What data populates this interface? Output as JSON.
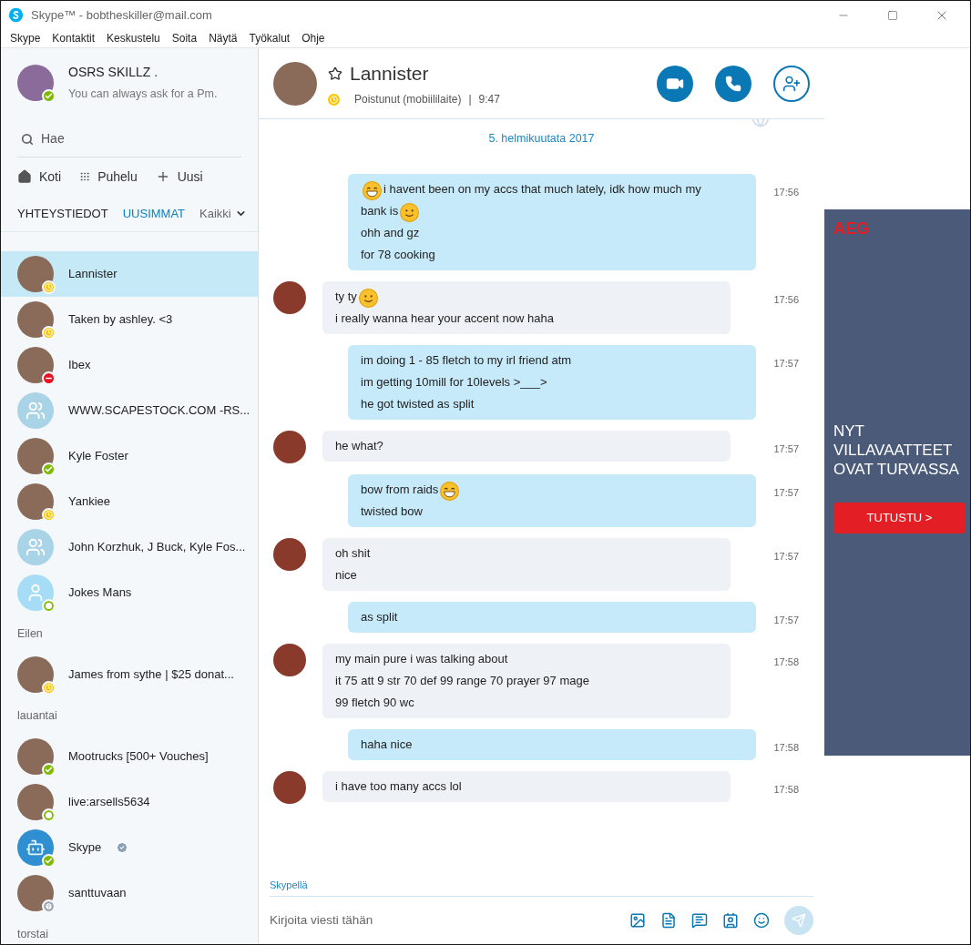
{
  "window": {
    "title": "Skype™ - bobtheskiller@mail.com"
  },
  "menu": [
    "Skype",
    "Kontaktit",
    "Keskustelu",
    "Soita",
    "Näytä",
    "Työkalut",
    "Ohje"
  ],
  "profile": {
    "name": "OSRS SKILLZ .",
    "mood": "You can always ask for a Pm.",
    "status": {
      "kind": "online",
      "color": "#7fba00"
    }
  },
  "search": {
    "placeholder": "Hae"
  },
  "nav": [
    {
      "kind": "home",
      "label": "Koti"
    },
    {
      "kind": "dialpad",
      "label": "Puhelu"
    },
    {
      "kind": "plus",
      "label": "Uusi"
    }
  ],
  "tabs": [
    {
      "label": "YHTEYSTIEDOT",
      "selected": false
    },
    {
      "label": "UUSIMMAT",
      "selected": true
    }
  ],
  "filter": {
    "label": "Kaikki"
  },
  "contact_sections": [
    {
      "contacts": [
        {
          "name": "Lannister",
          "kind": "photo",
          "status": {
            "kind": "away",
            "color": "#fdc400"
          },
          "selected": true
        },
        {
          "name": "Taken by ashley. <3",
          "kind": "photo",
          "status": {
            "kind": "away",
            "color": "#fdc400"
          },
          "selected": false
        },
        {
          "name": "Ibex",
          "kind": "photo",
          "status": {
            "kind": "busy",
            "color": "#e81123"
          },
          "selected": false
        },
        {
          "name": "WWW.SCAPESTOCK.COM -RS...",
          "kind": "group",
          "selected": false
        },
        {
          "name": "Kyle Foster",
          "kind": "photo",
          "status": {
            "kind": "online",
            "color": "#7fba00"
          },
          "selected": false
        },
        {
          "name": "Yankiee",
          "kind": "photo",
          "status": {
            "kind": "away",
            "color": "#fdc400"
          },
          "selected": false
        },
        {
          "name": "John Korzhuk, J Buck, Kyle Fos...",
          "kind": "group",
          "selected": false
        },
        {
          "name": "Jokes Mans",
          "kind": "person",
          "status": {
            "kind": "offline",
            "color": "#7fba00"
          },
          "selected": false
        }
      ]
    },
    {
      "label": "Eilen",
      "contacts": [
        {
          "name": "James from sythe | $25 donat...",
          "kind": "photo",
          "status": {
            "kind": "away",
            "color": "#fdc400"
          },
          "selected": false
        }
      ]
    },
    {
      "label": "lauantai",
      "contacts": [
        {
          "name": "Mootrucks [500+ Vouches]",
          "kind": "photo",
          "status": {
            "kind": "online",
            "color": "#7fba00"
          },
          "selected": false
        },
        {
          "name": "live:arsells5634",
          "kind": "photo",
          "status": {
            "kind": "offline",
            "color": "#7fba00"
          },
          "selected": false
        },
        {
          "name": "Skype",
          "kind": "bot",
          "status": {
            "kind": "online",
            "color": "#7fba00"
          },
          "selected": false,
          "verified": true
        },
        {
          "name": "santtuvaan",
          "kind": "photo",
          "status": {
            "kind": "unknown",
            "color": "#9aa5b1"
          },
          "selected": false
        }
      ]
    },
    {
      "label": "torstai"
    }
  ],
  "chat": {
    "name": "Lannister",
    "status": {
      "kind": "away",
      "color": "#fdc400"
    },
    "presence": "Poistunut (mobiililaite)",
    "separator": "|",
    "time": "9:47"
  },
  "date_label": "5. helmikuutata 2017",
  "messages": [
    {
      "kind": "sent",
      "time": "17:56",
      "lines": [
        {
          "text": "i havent been on my accs that much lately, idk how much my",
          "lead_emoji": {
            "kind": "grin"
          }
        },
        {
          "text": "bank is",
          "trail_emoji": {
            "kind": "smile"
          }
        },
        {
          "text": "ohh and gz"
        },
        {
          "text": "for 78 cooking"
        }
      ]
    },
    {
      "kind": "received",
      "time": "17:56",
      "lines": [
        {
          "text": "ty ty",
          "trail_emoji": {
            "kind": "smile"
          }
        },
        {
          "text": "i really wanna hear your accent now haha"
        }
      ]
    },
    {
      "kind": "sent",
      "time": "17:57",
      "lines": [
        {
          "text": "im doing 1 - 85 fletch to my irl friend atm"
        },
        {
          "text": "im getting 10mill for 10levels >___>"
        },
        {
          "text": "he got twisted as split"
        }
      ]
    },
    {
      "kind": "received",
      "time": "17:57",
      "lines": [
        {
          "text": "he what?"
        }
      ]
    },
    {
      "kind": "sent",
      "time": "17:57",
      "lines": [
        {
          "text": "bow from raids",
          "trail_emoji": {
            "kind": "grin"
          }
        },
        {
          "text": "twisted bow"
        }
      ]
    },
    {
      "kind": "received",
      "time": "17:57",
      "lines": [
        {
          "text": "oh shit"
        },
        {
          "text": "nice"
        }
      ]
    },
    {
      "kind": "sent",
      "time": "17:57",
      "lines": [
        {
          "text": "as split"
        }
      ]
    },
    {
      "kind": "received",
      "time": "17:58",
      "lines": [
        {
          "text": "my main pure i was talking about"
        },
        {
          "text": "it 75 att 9 str 70 def 99 range 70 prayer 97 mage"
        },
        {
          "text": "99 fletch 90 wc"
        }
      ]
    },
    {
      "kind": "sent",
      "time": "17:58",
      "lines": [
        {
          "text": "haha nice"
        }
      ]
    },
    {
      "kind": "received",
      "time": "17:58",
      "lines": [
        {
          "text": "i have too many accs lol"
        }
      ]
    }
  ],
  "composer": {
    "via": "Skypellä",
    "placeholder": "Kirjoita viesti tähän"
  },
  "ad": {
    "brand": "AEG",
    "headline": "NYT VILLAVAATTEET OVAT TURVASSA",
    "button": "TUTUSTU >"
  }
}
